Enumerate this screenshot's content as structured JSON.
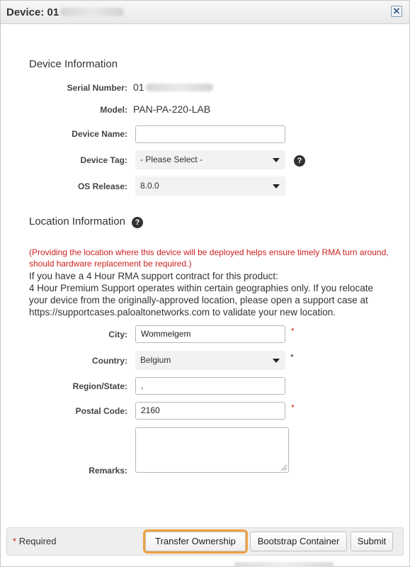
{
  "dialog": {
    "title_prefix": "Device: 01",
    "close_glyph": "✕"
  },
  "device_info": {
    "heading": "Device Information",
    "serial_label": "Serial Number:",
    "serial_value_prefix": "01",
    "model_label": "Model:",
    "model_value": "PAN-PA-220-LAB",
    "name_label": "Device Name:",
    "name_value": "",
    "tag_label": "Device Tag:",
    "tag_value": "- Please Select -",
    "os_label": "OS Release:",
    "os_value": "8.0.0"
  },
  "location": {
    "heading": "Location Information",
    "warning": "(Providing the location where this device will be deployed helps ensure timely RMA turn around, should hardware replacement be required.)",
    "notice_lines": [
      "If you have a 4 Hour RMA support contract for this product:",
      "4 Hour Premium Support operates within certain geographies only. If you relocate",
      "your device from the originally-approved location, please open a support case at",
      "https://supportcases.paloaltonetworks.com to validate your new location."
    ],
    "city_label": "City:",
    "city_value": "Wommelgem",
    "country_label": "Country:",
    "country_value": "Belgium",
    "region_label": "Region/State:",
    "region_value": ",",
    "postal_label": "Postal Code:",
    "postal_value": "2160",
    "remarks_label": "Remarks:",
    "remarks_value": ""
  },
  "help_glyph": "?",
  "required_star": "*",
  "footer": {
    "required_label": "Required",
    "transfer_label": "Transfer Ownership",
    "bootstrap_label": "Bootstrap Container",
    "submit_label": "Submit"
  },
  "colors": {
    "required_red": "#cc1f1f",
    "highlight_orange": "#f0a141"
  }
}
